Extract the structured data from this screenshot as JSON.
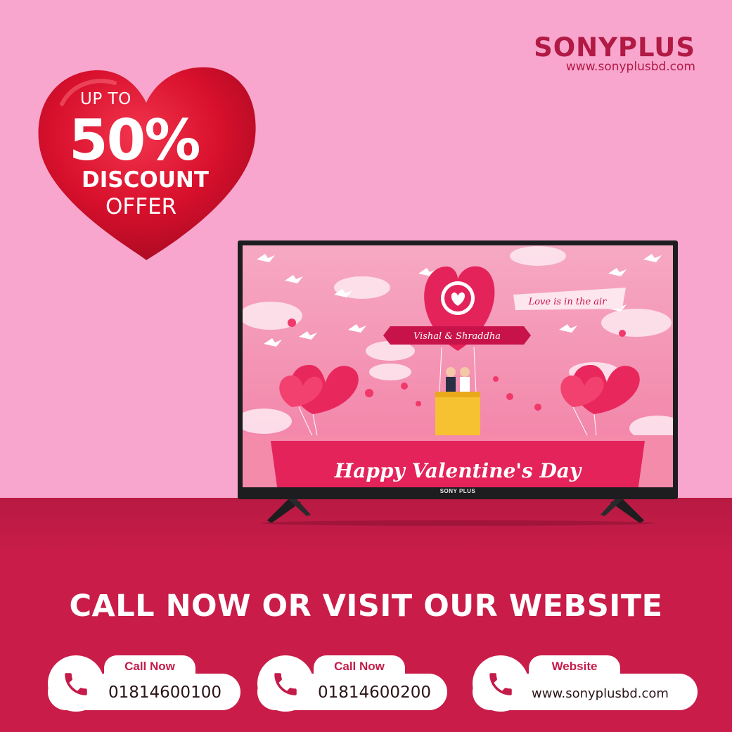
{
  "brand": {
    "name": "SONYPLUS",
    "url": "www.sonyplusbd.com",
    "color": "#b01a45"
  },
  "offer": {
    "line1": "UP TO",
    "percent": "50%",
    "line3": "DISCOUNT",
    "line4": "OFFER",
    "heart_color": "#d8102c"
  },
  "tv": {
    "brand_label": "SONY PLUS",
    "screen": {
      "banner_text": "Happy Valentine's Day",
      "couple_names": "Vishal & Shraddha",
      "ribbon_text": "Love is in the air"
    }
  },
  "cta": {
    "title": "CALL NOW OR VISIT OUR WEBSITE",
    "contacts": [
      {
        "label": "Call Now",
        "value": "01814600100",
        "icon": "phone-icon"
      },
      {
        "label": "Call Now",
        "value": "01814600200",
        "icon": "phone-icon"
      },
      {
        "label": "Website",
        "value": "www.sonyplusbd.com",
        "icon": "phone-icon"
      }
    ]
  },
  "colors": {
    "background": "#f8a6cd",
    "floor": "#c91c49",
    "accent": "#c41b48"
  }
}
